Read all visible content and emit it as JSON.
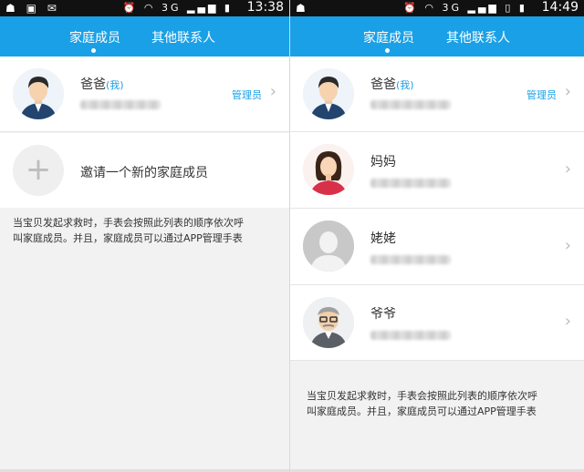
{
  "screens": [
    {
      "status": {
        "time": "13:38",
        "network": "3G"
      },
      "tabs": [
        {
          "label": "家庭成员"
        },
        {
          "label": "其他联系人"
        }
      ],
      "members": [
        {
          "name": "爸爸",
          "me_tag": "(我)",
          "role": "管理员",
          "avatar": "father-avatar-icon"
        }
      ],
      "invite": {
        "label": "邀请一个新的家庭成员"
      },
      "info": {
        "line1": "当宝贝发起求救时，手表会按照此列表的顺序依次呼",
        "line2": "叫家庭成员。并且，家庭成员可以通过APP管理手表"
      }
    },
    {
      "status": {
        "time": "14:49",
        "network": "3G"
      },
      "tabs": [
        {
          "label": "家庭成员"
        },
        {
          "label": "其他联系人"
        }
      ],
      "members": [
        {
          "name": "爸爸",
          "me_tag": "(我)",
          "role": "管理员",
          "avatar": "father-avatar-icon"
        },
        {
          "name": "妈妈",
          "avatar": "mother-avatar-icon"
        },
        {
          "name": "姥姥",
          "avatar": "default-avatar-icon"
        },
        {
          "name": "爷爷",
          "avatar": "grandpa-avatar-icon"
        }
      ],
      "info": {
        "line1": "当宝贝发起求救时，手表会按照此列表的顺序依次呼",
        "line2": "叫家庭成员。并且，家庭成员可以通过APP管理手表"
      }
    }
  ],
  "colors": {
    "accent": "#1aa0e6",
    "background": "#f2f2f2"
  }
}
